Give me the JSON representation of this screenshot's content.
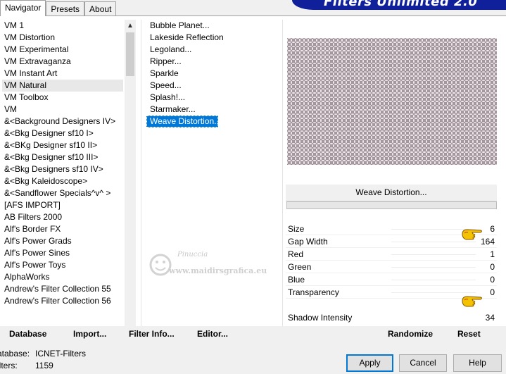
{
  "tabs": [
    {
      "label": "Navigator"
    },
    {
      "label": "Presets"
    },
    {
      "label": "About"
    }
  ],
  "banner": {
    "title": "Filters Unlimited 2.0"
  },
  "categories": [
    "VM 1",
    "VM Distortion",
    "VM Experimental",
    "VM Extravaganza",
    "VM Instant Art",
    "VM Natural",
    "VM Toolbox",
    "VM",
    "&<Background Designers IV>",
    "&<Bkg Designer sf10 I>",
    "&<BKg Designer sf10 II>",
    "&<Bkg Designer sf10 III>",
    "&<Bkg Designers sf10 IV>",
    "&<Bkg Kaleidoscope>",
    "&<Sandflower Specials^v^ >",
    "[AFS IMPORT]",
    "AB Filters 2000",
    "Alf's Border FX",
    "Alf's Power Grads",
    "Alf's Power Sines",
    "Alf's Power Toys",
    "AlphaWorks",
    "Andrew's Filter Collection 55",
    "Andrew's Filter Collection 56"
  ],
  "selected_category": "VM Natural",
  "filters": [
    "Bubble Planet...",
    "Lakeside Reflection",
    "Legoland...",
    "Ripper...",
    "Sparkle",
    "Speed...",
    "Splash!...",
    "Starmaker...",
    "Weave Distortion..."
  ],
  "selected_filter": "Weave Distortion...",
  "filter_title": "Weave Distortion...",
  "params": [
    {
      "label": "Size",
      "value": "6"
    },
    {
      "label": "Gap Width",
      "value": "164"
    },
    {
      "label": "Red",
      "value": "1"
    },
    {
      "label": "Green",
      "value": "0"
    },
    {
      "label": "Blue",
      "value": "0"
    },
    {
      "label": "Transparency",
      "value": "0"
    }
  ],
  "shadow": {
    "label": "Shadow Intensity",
    "value": "34"
  },
  "toolbar": {
    "database": "Database",
    "import": "Import...",
    "filter_info": "Filter Info...",
    "editor": "Editor...",
    "randomize": "Randomize",
    "reset": "Reset"
  },
  "status": {
    "database_label": "atabase:",
    "database_value": "ICNET-Filters",
    "filters_label": "ilters:",
    "filters_value": "1159"
  },
  "buttons": {
    "apply": "Apply",
    "cancel": "Cancel",
    "help": "Help"
  },
  "watermark": {
    "name": "Pinuccia",
    "url": "www.maidirsgrafica.eu"
  }
}
